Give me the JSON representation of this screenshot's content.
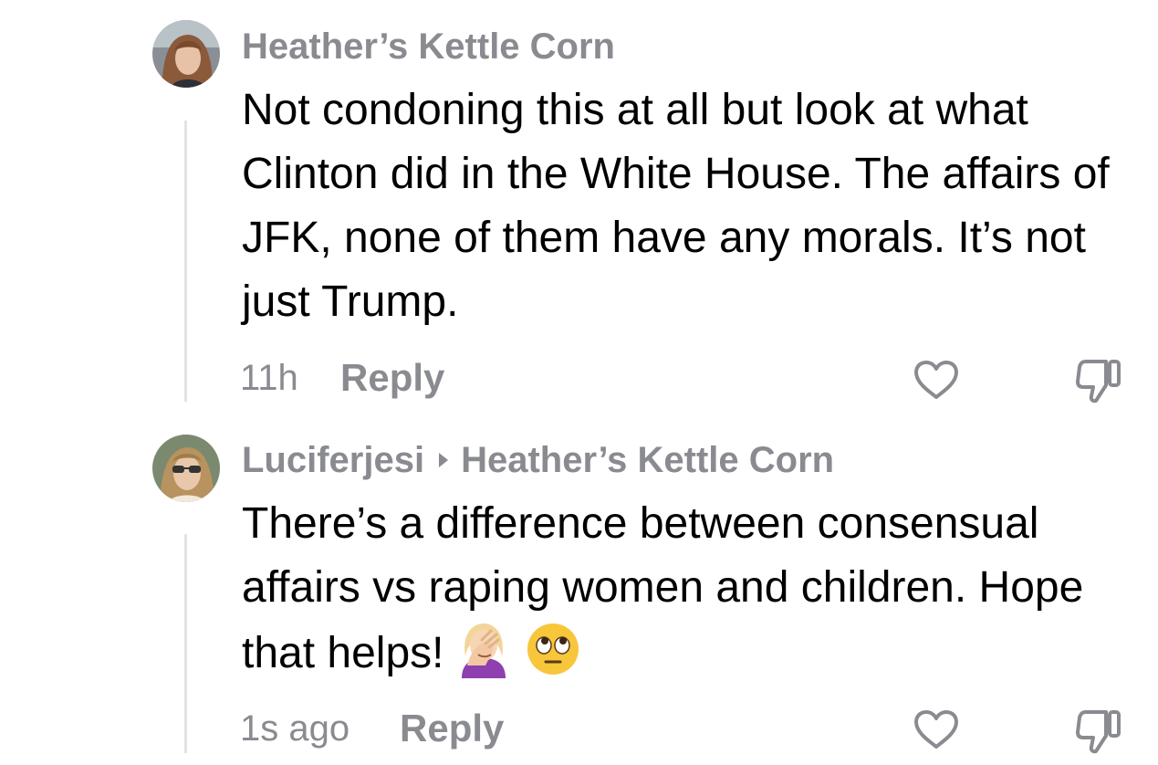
{
  "comments": [
    {
      "username": "Heather’s Kettle Corn",
      "text": "Not condoning this at all but look at what Clinton did in the White House. The affairs of JFK, none of them have any morals. It’s not just Trump.",
      "time": "11h",
      "reply_label": "Reply",
      "avatar_icon": "user-avatar-photo"
    },
    {
      "username": "Luciferjesi",
      "reply_to": "Heather’s Kettle Corn",
      "text": "There’s a difference between consensual affairs vs raping women and children. Hope that helps!",
      "emojis": [
        "woman-facepalming-emoji",
        "face-with-rolling-eyes-emoji"
      ],
      "time": "1s ago",
      "reply_label": "Reply",
      "avatar_icon": "user-avatar-photo"
    }
  ],
  "colors": {
    "meta_gray": "#8a8b91",
    "text": "#000000",
    "thread_line": "#e3e3e6"
  }
}
